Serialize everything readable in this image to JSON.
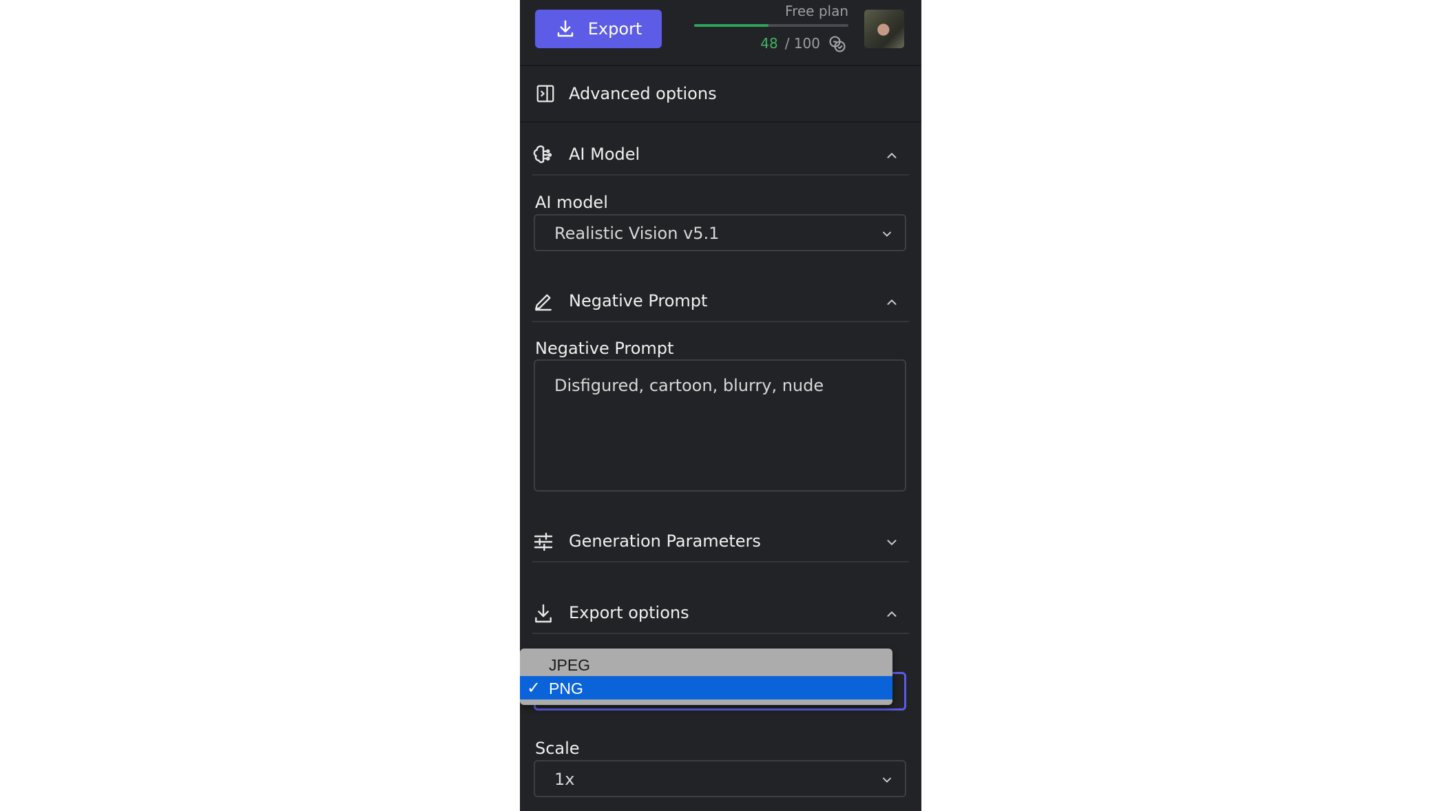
{
  "topbar": {
    "export_label": "Export",
    "plan": "Free plan",
    "credits_used": "48",
    "credits_total": "/ 100",
    "credits_fraction": 0.48,
    "credits_color": "#2fa35a",
    "accent": "#5d5ce6"
  },
  "advanced": {
    "label": "Advanced options"
  },
  "sections": {
    "ai_model": {
      "title": "AI Model",
      "field_label": "AI model",
      "value": "Realistic Vision v5.1",
      "expanded": true
    },
    "negative_prompt": {
      "title": "Negative Prompt",
      "field_label": "Negative Prompt",
      "value": "Disfigured, cartoon, blurry, nude",
      "expanded": true
    },
    "generation": {
      "title": "Generation Parameters",
      "expanded": false
    },
    "export": {
      "title": "Export options",
      "expanded": true,
      "format_options": [
        "JPEG",
        "PNG"
      ],
      "format_selected": "PNG",
      "check": "✓",
      "scale_label": "Scale",
      "scale_value": "1x"
    }
  },
  "icons": [
    "download-icon",
    "coins-icon",
    "panel-toggle-icon",
    "brain-icon",
    "pencil-icon",
    "sliders-icon",
    "chevron-up-icon",
    "chevron-down-icon",
    "check-icon"
  ]
}
